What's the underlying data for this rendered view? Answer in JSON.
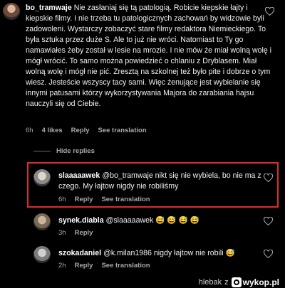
{
  "comments": {
    "main": {
      "username": "bo_tramwaje",
      "text": "Nie zasłaniaj się tą patologią. Robicie kiepskie łajty i kiepskie filmy. I nie trzeba tu patologicznych zachowań by widzowie byli zadowoleni. Wystarczy zobaczyć stare filmy redaktora Niemieckiego. To była sztuka przez duże S. Ale to już nie wróci. Natomiast to Ty go namawiałes żeby został w lesie na mrozie. I nie mów że miał wolną wolę i mógł wrócić. To samo można powiedzieć o chlaniu z Dryblasem. Miał wolną wolę i mógł nie pić. Zresztą na szkolnej też było pite i dobrze o tym wiesz. Jesteście wszyscy tacy sami. Więc żenujące jest wybielanie się innymi patusami którzy wykorzystywania Majora do zarabiania hajsu nauczyli się od Ciebie.",
      "time": "6h",
      "likes": "4 likes",
      "reply": "Reply",
      "translate": "See translation"
    },
    "hide_replies": "Hide replies",
    "replies": [
      {
        "username": "slaaaaawek",
        "text": "@bo_tramwaje nikt się nie wybiela, bo nie ma z czego. My łajtow nigdy nie robiliśmy",
        "time": "6h",
        "reply": "Reply",
        "translate": "See translation"
      },
      {
        "username": "synek.diabla",
        "text": "@slaaaaawek 😅 😅 😅 😅",
        "time": "3h",
        "reply": "Reply"
      },
      {
        "username": "szokadaniel",
        "text": "@k.milan1986 nigdy łajtow nie robili 😅",
        "time": "2h",
        "reply": "Reply",
        "translate": "See translation"
      }
    ]
  },
  "footer": {
    "author": "hlebak",
    "separator": "z",
    "site": "wykop.pl"
  },
  "colors": {
    "background": "#000000",
    "highlight": "#e02b2b",
    "muted": "#a8a8a8"
  },
  "icons": {
    "like": "heart-icon",
    "logo": "wykop-logo-icon"
  }
}
